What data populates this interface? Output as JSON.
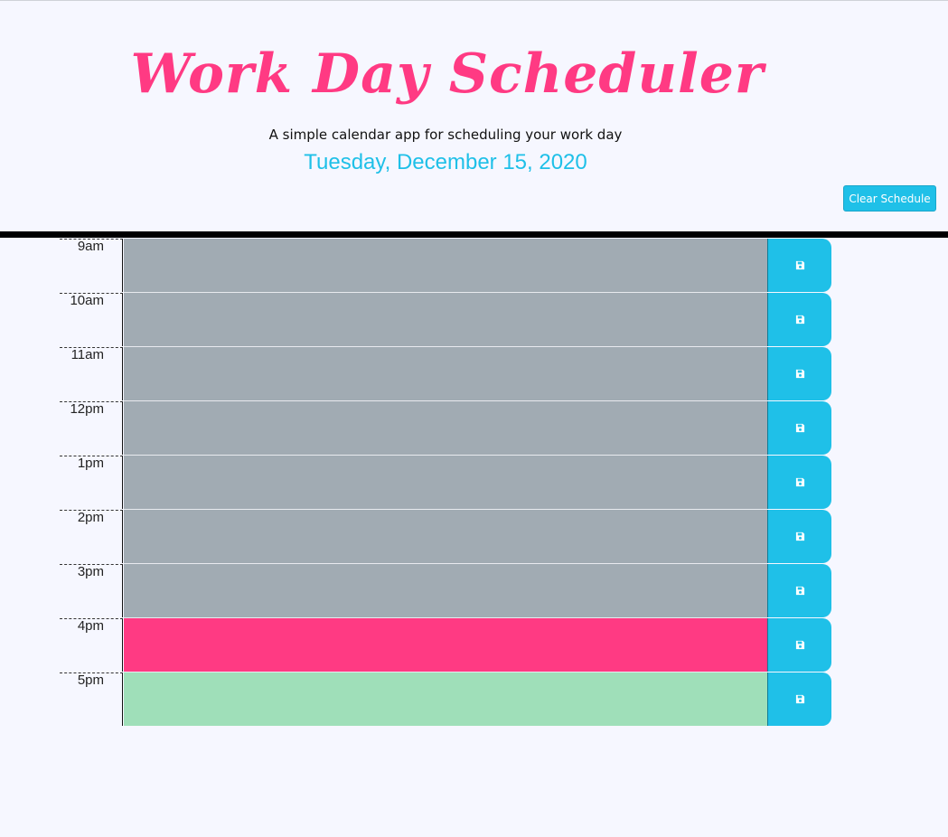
{
  "header": {
    "title": "Work Day Scheduler",
    "subtitle": "A simple calendar app for scheduling your work day",
    "current_day": "Tuesday, December 15, 2020",
    "clear_label": "Clear Schedule"
  },
  "colors": {
    "accent": "#1fc0e8",
    "title": "#ff3a83",
    "past": "#a1abb3",
    "present": "#ff3a83",
    "future": "#9fdfb9",
    "background": "#f6f7ff"
  },
  "schedule": {
    "rows": [
      {
        "hour": "9am",
        "status": "past",
        "text": "",
        "save_icon": "save-icon"
      },
      {
        "hour": "10am",
        "status": "past",
        "text": "",
        "save_icon": "save-icon"
      },
      {
        "hour": "11am",
        "status": "past",
        "text": "",
        "save_icon": "save-icon"
      },
      {
        "hour": "12pm",
        "status": "past",
        "text": "",
        "save_icon": "save-icon"
      },
      {
        "hour": "1pm",
        "status": "past",
        "text": "",
        "save_icon": "save-icon"
      },
      {
        "hour": "2pm",
        "status": "past",
        "text": "",
        "save_icon": "save-icon"
      },
      {
        "hour": "3pm",
        "status": "past",
        "text": "",
        "save_icon": "save-icon"
      },
      {
        "hour": "4pm",
        "status": "present",
        "text": "",
        "save_icon": "save-icon"
      },
      {
        "hour": "5pm",
        "status": "future",
        "text": "",
        "save_icon": "save-icon"
      }
    ]
  }
}
